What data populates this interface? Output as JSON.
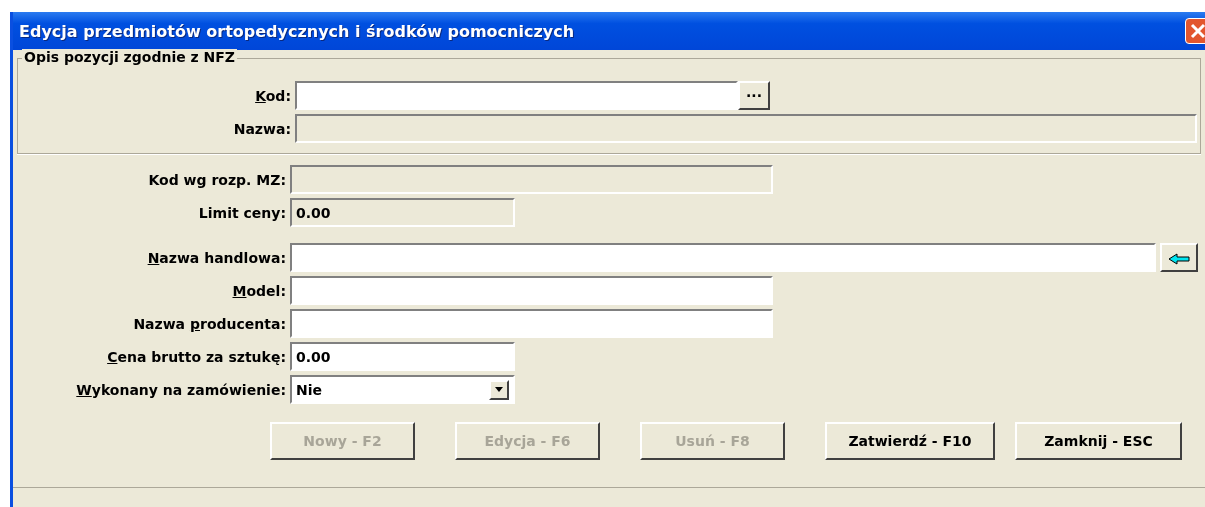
{
  "window": {
    "title": "Edycja przedmiotów ortopedycznych i środków pomocniczych"
  },
  "group": {
    "title": "Opis pozycji zgodnie z NFZ",
    "fields": [
      {
        "kind": "browse",
        "label": {
          "underlined": "K",
          "after": "od:"
        },
        "disabled": false,
        "button": "···"
      },
      {
        "kind": "text",
        "label": {
          "before": "Nazwa:"
        },
        "disabled": true
      }
    ]
  },
  "fields": [
    {
      "kind": "text",
      "label": {
        "before": "Kod wg rozp. MZ:"
      },
      "disabled": true
    },
    {
      "kind": "text",
      "label": {
        "before": "Limit ceny:"
      },
      "value": "0.00",
      "disabled": true
    },
    {
      "kind": "arrow",
      "label": {
        "underlined": "N",
        "after": "azwa handlowa:"
      },
      "disabled": false
    },
    {
      "kind": "text",
      "label": {
        "underlined": "M",
        "after": "odel:"
      },
      "disabled": false
    },
    {
      "kind": "text",
      "label": {
        "before": "Nazwa ",
        "underlined": "p",
        "after": "roducenta:"
      },
      "disabled": false
    },
    {
      "kind": "text",
      "label": {
        "underlined": "C",
        "after": "ena brutto za sztukę:"
      },
      "value": "0.00",
      "disabled": false
    },
    {
      "kind": "dropdown",
      "label": {
        "underlined": "W",
        "after": "ykonany na zamówienie:"
      },
      "value": "Nie",
      "disabled": false
    }
  ],
  "buttons": [
    {
      "label": "Nowy - F2",
      "disabled": true
    },
    {
      "label": "Edycja - F6",
      "disabled": true
    },
    {
      "label": "Usuń - F8",
      "disabled": true
    },
    {
      "label": "Zatwierdź - F10",
      "disabled": false
    },
    {
      "label": "Zamknij - ESC",
      "disabled": false
    }
  ]
}
